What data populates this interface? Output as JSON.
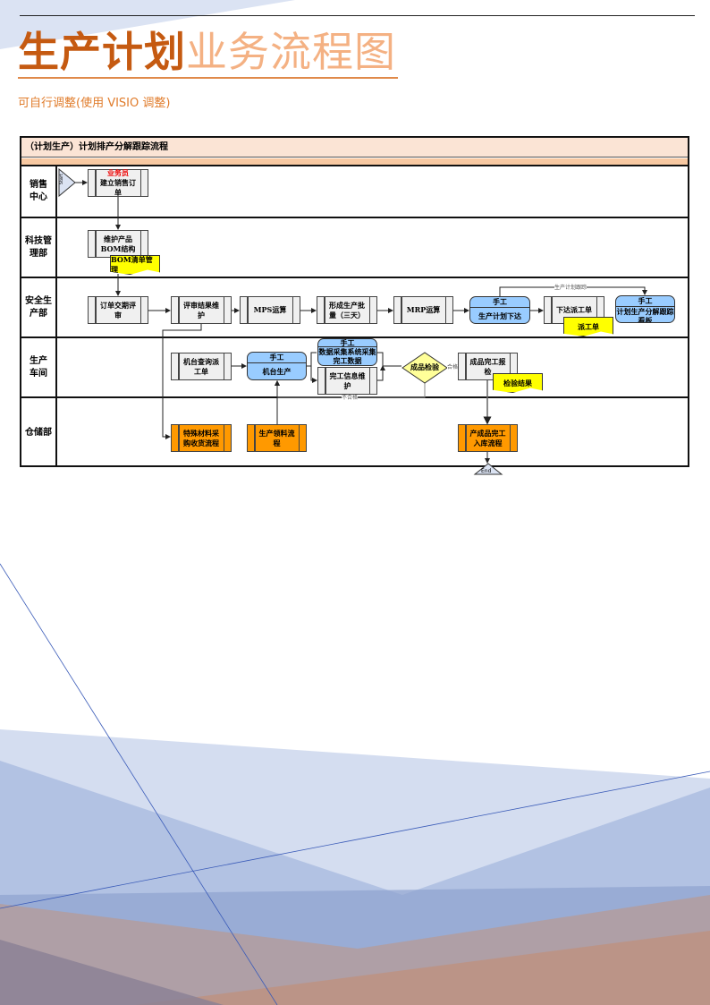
{
  "header": {
    "title_bold": "生产计划",
    "title_light": "业务流程图",
    "subtitle": "可自行调整(使用 VISIO 调整)"
  },
  "diagram": {
    "title": "（计划生产）计划排产分解跟踪流程",
    "lanes": [
      "销售\n中心",
      "科技管\n理部",
      "安全生\n产部",
      "生产\n车间",
      "仓储部"
    ],
    "start": "Start",
    "end": "End",
    "sales_order": {
      "role": "业务员",
      "label": "建立销售订单"
    },
    "bom": "维护产品BOM结构",
    "bom_doc": "BOM清单管理",
    "review": "订单交期评审",
    "review_maint": "评审结果维护",
    "mps": "MPS运算",
    "batch": "形成生产批量（三天）",
    "mrp": "MRP运算",
    "manual": "手工",
    "plan_issue": "生产计划下达",
    "dispatch": "下达派工单",
    "dispatch_doc": "派工单",
    "board": "计划生产分解跟踪看板",
    "track_label": "生产计划跟踪",
    "machine_query": "机台查询派工单",
    "machine_prod": "机台生产",
    "data_collect": "数据采集系统采集完工数据",
    "finish_maint": "完工信息维护",
    "inspect": "成品检验",
    "pass": "合格",
    "fail": "不合格",
    "report": "成品完工报检",
    "inspect_doc": "检验结果",
    "special": "特殊材料采购收货流程",
    "picking": "生产领料流程",
    "warehouse_in": "产成品完工入库流程"
  }
}
